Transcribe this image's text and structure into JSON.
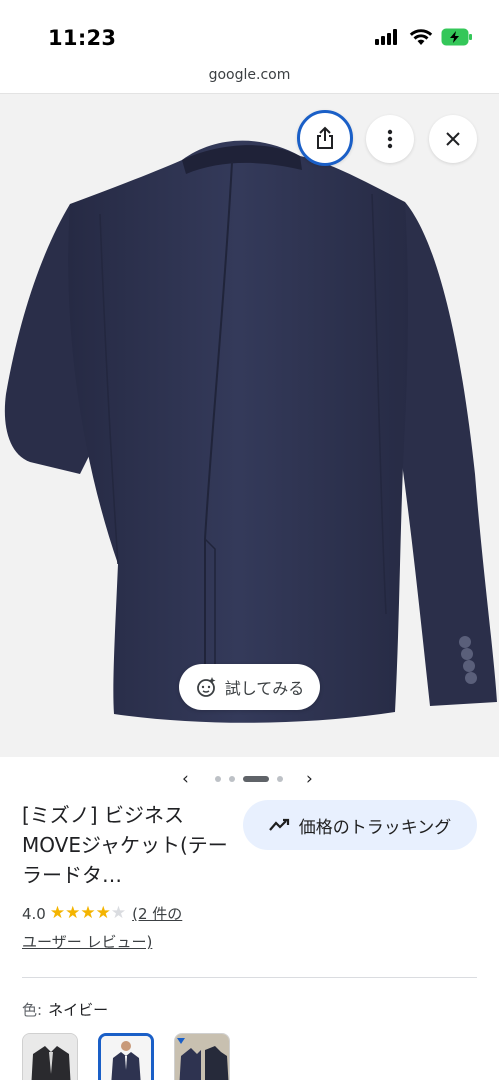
{
  "status_bar": {
    "time": "11:23"
  },
  "browser": {
    "url": "google.com"
  },
  "image_viewer": {
    "share_icon": "share-icon",
    "more_icon": "more-vert-icon",
    "close_icon": "close-icon",
    "try_on_label": "試してみる",
    "image_count": 4,
    "active_image_index": 2
  },
  "product": {
    "title": "[ミズノ] ビジネスMOVEジャケット(テーラードタ…",
    "track_price_label": "価格のトラッキング",
    "rating": "4.0",
    "stars_filled": 4,
    "stars_total": 5,
    "review_text_1": "(2 件の",
    "review_text_2": "ユーザー レビュー)",
    "color_label": "色:",
    "color_value": "ネイビー",
    "variants": [
      "black",
      "navy",
      "navy-alt"
    ],
    "selected_variant": 1
  },
  "colors": {
    "accent": "#1a5fc7",
    "track_bg": "#e8f0fe",
    "star": "#f4b400",
    "jacket": "#2e3350"
  }
}
